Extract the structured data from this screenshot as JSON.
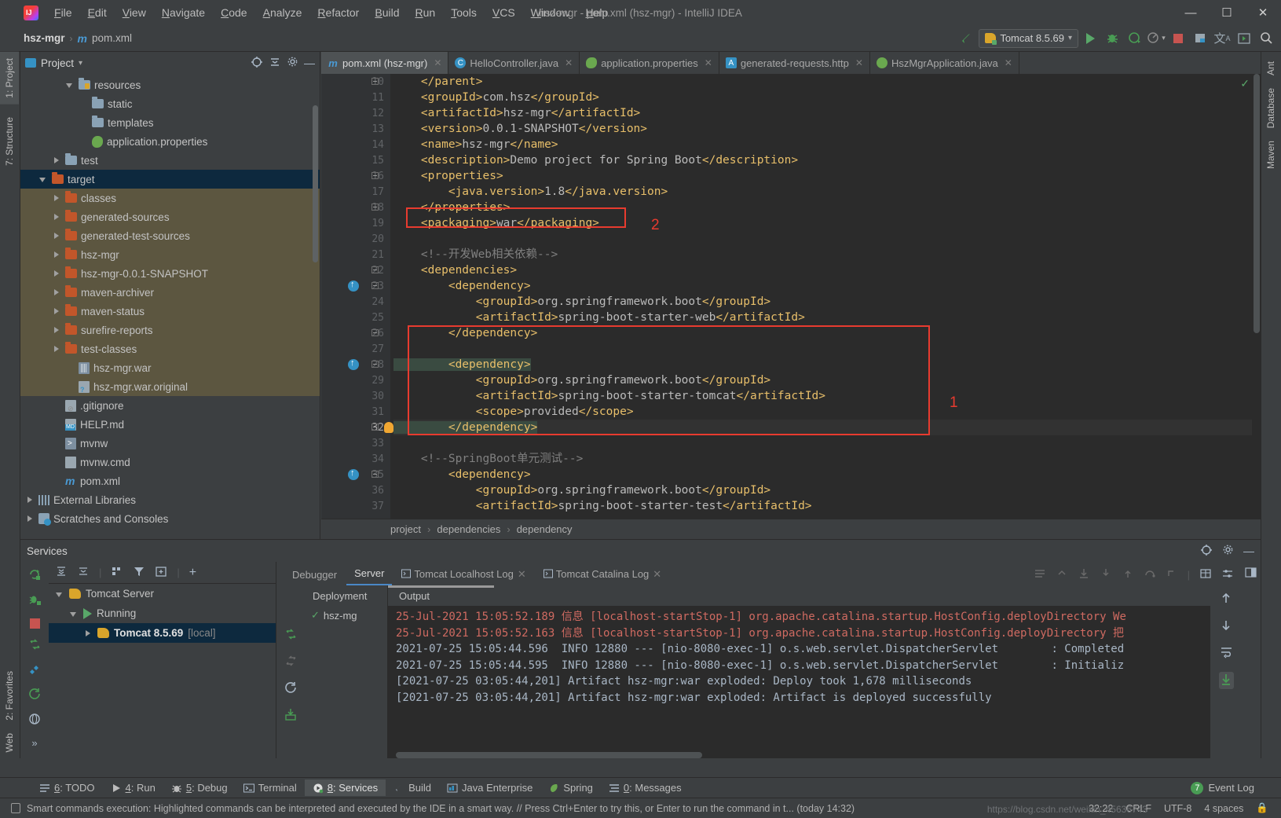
{
  "window": {
    "title": "hsz-mgr - pom.xml (hsz-mgr) - IntelliJ IDEA",
    "minimize": "—",
    "maximize": "☐",
    "close": "✕"
  },
  "menu": [
    {
      "label": "File"
    },
    {
      "label": "Edit"
    },
    {
      "label": "View"
    },
    {
      "label": "Navigate"
    },
    {
      "label": "Code"
    },
    {
      "label": "Analyze"
    },
    {
      "label": "Refactor"
    },
    {
      "label": "Build"
    },
    {
      "label": "Run"
    },
    {
      "label": "Tools"
    },
    {
      "label": "VCS"
    },
    {
      "label": "Window"
    },
    {
      "label": "Help"
    }
  ],
  "navbar": {
    "project": "hsz-mgr",
    "separator": "›",
    "file": "pom.xml",
    "run_config": "Tomcat 8.5.69",
    "dropdown_caret": "▾"
  },
  "left_stripe": [
    {
      "label": "1: Project"
    },
    {
      "label": "7: Structure"
    }
  ],
  "bottom_left_stripe": [
    {
      "label": "2: Favorites"
    },
    {
      "label": "Web"
    }
  ],
  "right_stripe": [
    {
      "label": "Ant"
    },
    {
      "label": "Database"
    },
    {
      "label": "Maven"
    }
  ],
  "project_panel": {
    "title": "Project",
    "caret": "▾",
    "tree": [
      {
        "label": "resources",
        "indent": 3,
        "arrow": "down",
        "icon": "resources-folder"
      },
      {
        "label": "static",
        "indent": 4,
        "arrow": "none",
        "icon": "folder"
      },
      {
        "label": "templates",
        "indent": 4,
        "arrow": "none",
        "icon": "folder"
      },
      {
        "label": "application.properties",
        "indent": 4,
        "arrow": "none",
        "icon": "spring-properties"
      },
      {
        "label": "test",
        "indent": 2,
        "arrow": "right",
        "icon": "folder"
      },
      {
        "label": "target",
        "indent": 1,
        "arrow": "down",
        "icon": "folder-orange",
        "selected": true
      },
      {
        "label": "classes",
        "indent": 2,
        "arrow": "right",
        "icon": "folder-orange",
        "excluded": true
      },
      {
        "label": "generated-sources",
        "indent": 2,
        "arrow": "right",
        "icon": "folder-orange",
        "excluded": true
      },
      {
        "label": "generated-test-sources",
        "indent": 2,
        "arrow": "right",
        "icon": "folder-orange",
        "excluded": true
      },
      {
        "label": "hsz-mgr",
        "indent": 2,
        "arrow": "right",
        "icon": "folder-orange",
        "excluded": true
      },
      {
        "label": "hsz-mgr-0.0.1-SNAPSHOT",
        "indent": 2,
        "arrow": "right",
        "icon": "folder-orange",
        "excluded": true
      },
      {
        "label": "maven-archiver",
        "indent": 2,
        "arrow": "right",
        "icon": "folder-orange",
        "excluded": true
      },
      {
        "label": "maven-status",
        "indent": 2,
        "arrow": "right",
        "icon": "folder-orange",
        "excluded": true
      },
      {
        "label": "surefire-reports",
        "indent": 2,
        "arrow": "right",
        "icon": "folder-orange",
        "excluded": true
      },
      {
        "label": "test-classes",
        "indent": 2,
        "arrow": "right",
        "icon": "folder-orange",
        "excluded": true
      },
      {
        "label": "hsz-mgr.war",
        "indent": 3,
        "arrow": "none",
        "icon": "war-archive",
        "excluded": true
      },
      {
        "label": "hsz-mgr.war.original",
        "indent": 3,
        "arrow": "none",
        "icon": "unknown-file",
        "excluded": true
      },
      {
        "label": ".gitignore",
        "indent": 2,
        "arrow": "none",
        "icon": "gitignore-file"
      },
      {
        "label": "HELP.md",
        "indent": 2,
        "arrow": "none",
        "icon": "markdown-file"
      },
      {
        "label": "mvnw",
        "indent": 2,
        "arrow": "none",
        "icon": "shell-file"
      },
      {
        "label": "mvnw.cmd",
        "indent": 2,
        "arrow": "none",
        "icon": "cmd-file"
      },
      {
        "label": "pom.xml",
        "indent": 2,
        "arrow": "none",
        "icon": "maven-file"
      },
      {
        "label": "External Libraries",
        "indent": 0,
        "arrow": "right",
        "icon": "library"
      },
      {
        "label": "Scratches and Consoles",
        "indent": 0,
        "arrow": "right",
        "icon": "scratches"
      }
    ]
  },
  "editor": {
    "tabs": [
      {
        "label": "pom.xml (hsz-mgr)",
        "icon": "maven-file",
        "active": true,
        "close": "✕"
      },
      {
        "label": "HelloController.java",
        "icon": "java-class",
        "active": false,
        "close": "✕"
      },
      {
        "label": "application.properties",
        "icon": "spring-properties",
        "active": false,
        "close": "✕"
      },
      {
        "label": "generated-requests.http",
        "icon": "http-file",
        "active": false,
        "close": "✕"
      },
      {
        "label": "HszMgrApplication.java",
        "icon": "spring-class",
        "active": false,
        "close": "✕"
      }
    ],
    "lines": [
      {
        "n": 10,
        "text": "    </parent>",
        "fold": true
      },
      {
        "n": 11,
        "text": "    <groupId>com.hsz</groupId>"
      },
      {
        "n": 12,
        "text": "    <artifactId>hsz-mgr</artifactId>"
      },
      {
        "n": 13,
        "text": "    <version>0.0.1-SNAPSHOT</version>"
      },
      {
        "n": 14,
        "text": "    <name>hsz-mgr</name>"
      },
      {
        "n": 15,
        "text": "    <description>Demo project for Spring Boot</description>"
      },
      {
        "n": 16,
        "text": "    <properties>",
        "fold": true
      },
      {
        "n": 17,
        "text": "        <java.version>1.8</java.version>"
      },
      {
        "n": 18,
        "text": "    </properties>",
        "fold": true
      },
      {
        "n": 19,
        "text": "    <packaging>war</packaging>"
      },
      {
        "n": 20,
        "text": ""
      },
      {
        "n": 21,
        "text": "    <!--开发Web相关依赖-->",
        "comment": true
      },
      {
        "n": 22,
        "text": "    <dependencies>",
        "fold": true
      },
      {
        "n": 23,
        "text": "        <dependency>",
        "fold": true,
        "gutter_mark": true
      },
      {
        "n": 24,
        "text": "            <groupId>org.springframework.boot</groupId>"
      },
      {
        "n": 25,
        "text": "            <artifactId>spring-boot-starter-web</artifactId>"
      },
      {
        "n": 26,
        "text": "        </dependency>",
        "fold": true
      },
      {
        "n": 27,
        "text": ""
      },
      {
        "n": 28,
        "text": "        <dependency>",
        "fold": true,
        "gutter_mark": true,
        "highlight": true
      },
      {
        "n": 29,
        "text": "            <groupId>org.springframework.boot</groupId>"
      },
      {
        "n": 30,
        "text": "            <artifactId>spring-boot-starter-tomcat</artifactId>"
      },
      {
        "n": 31,
        "text": "            <scope>provided</scope>"
      },
      {
        "n": 32,
        "text": "        </dependency>",
        "fold": true,
        "bulb": true,
        "highlight": true,
        "current": true
      },
      {
        "n": 33,
        "text": ""
      },
      {
        "n": 34,
        "text": "    <!--SpringBoot单元测试-->",
        "comment": true
      },
      {
        "n": 35,
        "text": "        <dependency>",
        "fold": true,
        "gutter_mark": true
      },
      {
        "n": 36,
        "text": "            <groupId>org.springframework.boot</groupId>"
      },
      {
        "n": 37,
        "text": "            <artifactId>spring-boot-starter-test</artifactId>"
      }
    ],
    "annotations": [
      {
        "label": "2"
      },
      {
        "label": "1"
      }
    ],
    "breadcrumb": [
      "project",
      "dependencies",
      "dependency"
    ],
    "breadcrumb_sep": "›"
  },
  "services": {
    "title": "Services",
    "tree": [
      {
        "label": "Tomcat Server",
        "indent": 0,
        "arrow": "down",
        "icon": "tomcat-icon"
      },
      {
        "label": "Running",
        "indent": 1,
        "arrow": "down",
        "icon": "run-icon"
      },
      {
        "label": "Tomcat 8.5.69",
        "suffix": " [local]",
        "indent": 2,
        "arrow": "right",
        "icon": "tomcat-icon",
        "selected": true
      }
    ],
    "tabs": [
      {
        "label": "Debugger",
        "active": false
      },
      {
        "label": "Server",
        "active": true
      },
      {
        "label": "Tomcat Localhost Log",
        "active": false,
        "close": "✕"
      },
      {
        "label": "Tomcat Catalina Log",
        "active": false,
        "close": "✕"
      }
    ],
    "deployment_header": "Deployment",
    "deployment_items": [
      {
        "label": "hsz-mg",
        "status": "✓"
      }
    ],
    "output_header": "Output",
    "console_lines": [
      {
        "text": "[2021-07-25 03:05:44,201] Artifact hsz-mgr:war exploded: Artifact is deployed successfully",
        "red": false
      },
      {
        "text": "[2021-07-25 03:05:44,201] Artifact hsz-mgr:war exploded: Deploy took 1,678 milliseconds",
        "red": false
      },
      {
        "text": "2021-07-25 15:05:44.595  INFO 12880 --- [nio-8080-exec-1] o.s.web.servlet.DispatcherServlet        : Initializ",
        "red": false
      },
      {
        "text": "2021-07-25 15:05:44.596  INFO 12880 --- [nio-8080-exec-1] o.s.web.servlet.DispatcherServlet        : Completed",
        "red": false
      },
      {
        "text": "25-Jul-2021 15:05:52.163 信息 [localhost-startStop-1] org.apache.catalina.startup.HostConfig.deployDirectory 把",
        "red": true
      },
      {
        "text": "25-Jul-2021 15:05:52.189 信息 [localhost-startStop-1] org.apache.catalina.startup.HostConfig.deployDirectory We",
        "red": true
      }
    ]
  },
  "tool_window_bar": {
    "left": [
      {
        "label": "6: TODO",
        "icon": "todo-icon",
        "active": false
      },
      {
        "label": "4: Run",
        "icon": "run-icon",
        "active": false
      },
      {
        "label": "5: Debug",
        "icon": "debug-icon",
        "active": false
      },
      {
        "label": "Terminal",
        "icon": "terminal-icon",
        "active": false
      },
      {
        "label": "8: Services",
        "icon": "services-icon",
        "active": true
      },
      {
        "label": "Build",
        "icon": "build-icon",
        "active": false
      },
      {
        "label": "Java Enterprise",
        "icon": "java-enterprise-icon",
        "active": false
      },
      {
        "label": "Spring",
        "icon": "spring-icon",
        "active": false
      },
      {
        "label": "0: Messages",
        "icon": "messages-icon",
        "active": false
      }
    ],
    "event_log": {
      "label": "Event Log",
      "badge": "7"
    }
  },
  "status_bar": {
    "message": "Smart commands execution: Highlighted commands can be interpreted and executed by the IDE in a smart way. // Press Ctrl+Enter to try this, or Enter to run the command in t... (today 14:32)",
    "position": "32:22",
    "encoding": "UTF-8",
    "line_sep": "CRLF",
    "indent": "4 spaces",
    "watermark": "https://blog.csdn.net/weixin_45636743"
  },
  "colors": {
    "accent_blue": "#3592c4",
    "selection": "#0d293e",
    "annotation_red": "#e83b2f",
    "tag": "#e8bf6a",
    "value": "#a9b7c6",
    "comment": "#808080",
    "highlight_green": "#3a4b41",
    "excluded_folder": "#5c5640",
    "error_red": "#cf6a61"
  }
}
